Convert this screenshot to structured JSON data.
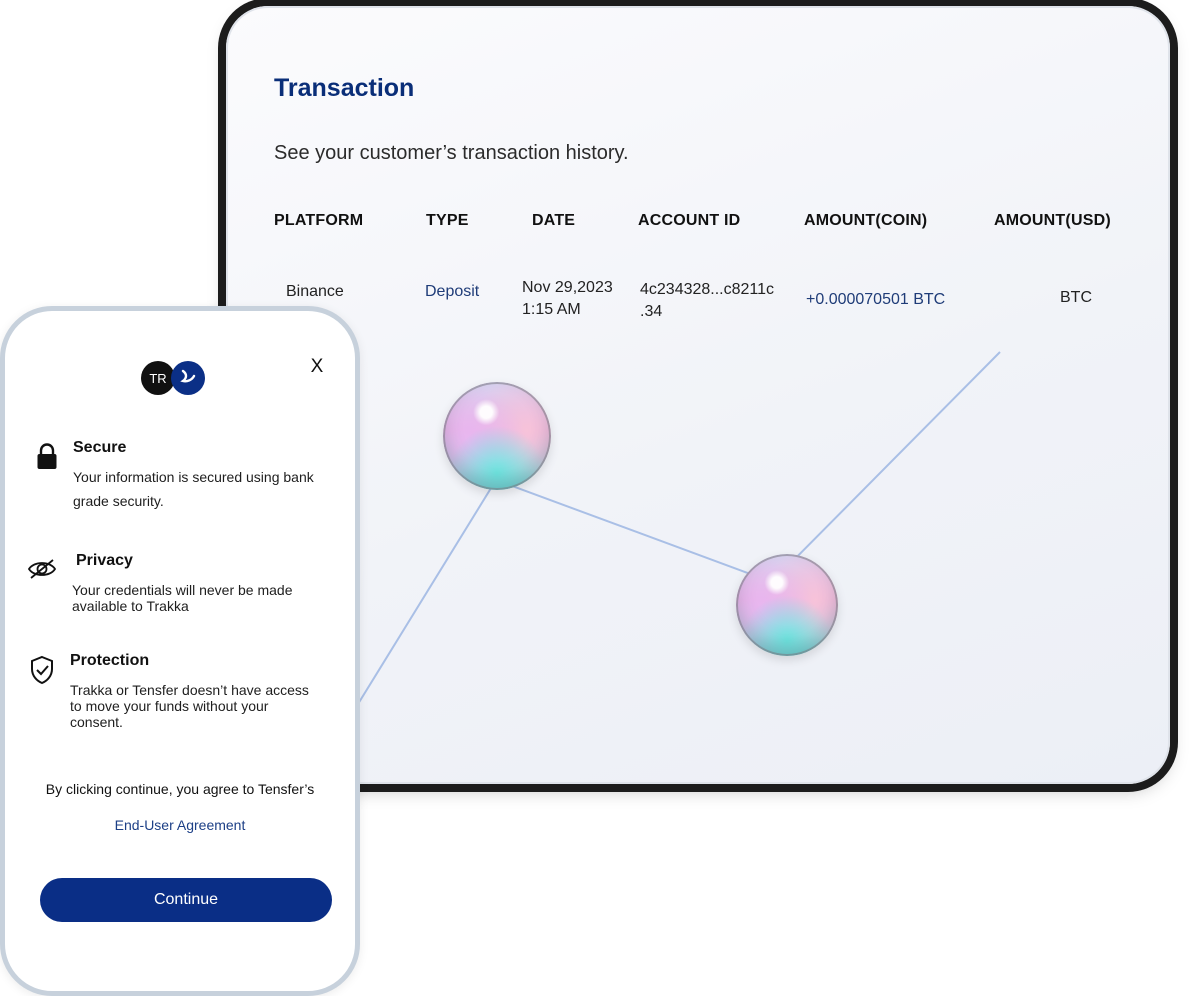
{
  "transaction": {
    "title": "Transaction",
    "subtitle": "See your customer’s transaction history.",
    "columns": [
      "PLATFORM",
      "TYPE",
      "DATE",
      "ACCOUNT ID",
      "AMOUNT(COIN)",
      "AMOUNT(USD)"
    ],
    "row": {
      "platform": "Binance",
      "type": "Deposit",
      "date_line1": "Nov 29,2023",
      "date_line2": "1:15 AM",
      "account_line1": "4c234328...c8211c",
      "account_line2": ".34",
      "amount_coin": "+0.000070501 BTC",
      "amount_usd": "BTC"
    }
  },
  "modal": {
    "logo_initials": "TR",
    "close_label": "X",
    "features": [
      {
        "icon": "lock-icon",
        "title": "Secure",
        "desc_line1": "Your information is secured using bank",
        "desc_line2": "grade security."
      },
      {
        "icon": "eye-slash-icon",
        "title": "Privacy",
        "desc_line1": "Your credentials will never be made",
        "desc_line2": "available to Trakka"
      },
      {
        "icon": "shield-check-icon",
        "title": "Protection",
        "desc_line1": "Trakka or Tensfer doesn’t have access",
        "desc_line2": "to move your funds without your",
        "desc_line3": "consent."
      }
    ],
    "agree_text": "By clicking continue, you agree to Tensfer’s",
    "agree_link": "End-User Agreement",
    "continue_label": "Continue"
  },
  "colors": {
    "accent": "#0a2e86",
    "title": "#0a2e78",
    "link": "#1f3c78"
  }
}
